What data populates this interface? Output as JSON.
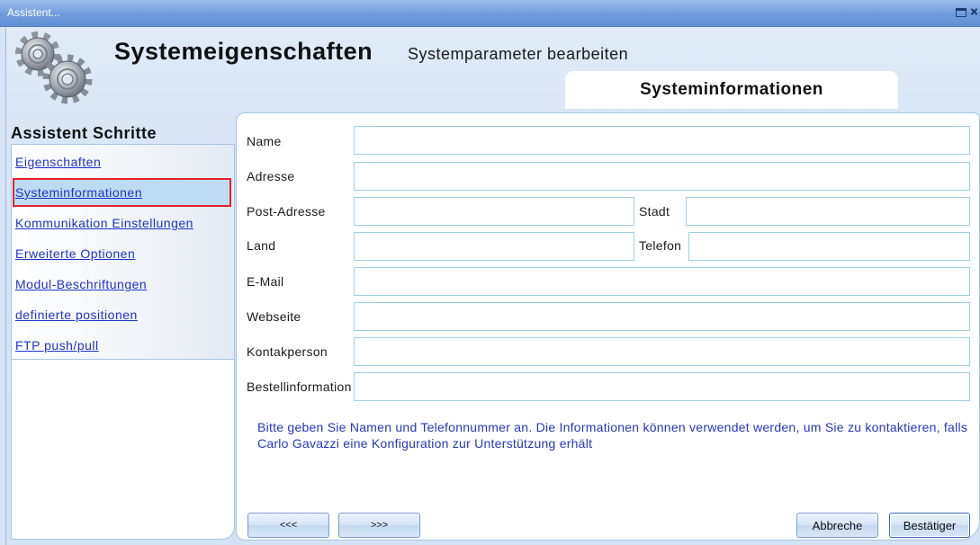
{
  "window": {
    "title": "Assistent...",
    "header_title": "Systemeigenschaften",
    "header_subtitle": "Systemparameter bearbeiten"
  },
  "tabs": [
    {
      "label": "Systeminformationen",
      "active": true
    }
  ],
  "sidebar": {
    "heading": "Assistent Schritte",
    "selected_index": 1,
    "items": [
      {
        "label": "Eigenschaften"
      },
      {
        "label": "Systeminformationen"
      },
      {
        "label": "Kommunikation Einstellungen"
      },
      {
        "label": "Erweiterte Optionen"
      },
      {
        "label": "Modul-Beschriftungen"
      },
      {
        "label": "definierte positionen"
      },
      {
        "label": "FTP push/pull"
      }
    ]
  },
  "form": {
    "name": {
      "label": "Name",
      "value": ""
    },
    "adresse": {
      "label": "Adresse",
      "value": ""
    },
    "post_adresse": {
      "label": "Post-Adresse",
      "value": ""
    },
    "stadt": {
      "label": "Stadt",
      "value": ""
    },
    "land": {
      "label": "Land",
      "value": ""
    },
    "telefon": {
      "label": "Telefon",
      "value": ""
    },
    "email": {
      "label": "E-Mail",
      "value": ""
    },
    "webseite": {
      "label": "Webseite",
      "value": ""
    },
    "kontaktperson": {
      "label": "Kontakperson",
      "value": ""
    },
    "bestellinformation": {
      "label": "Bestellinformation",
      "value": ""
    }
  },
  "info_text": {
    "line1": "Bitte geben Sie Namen und Telefonnummer an. Die Informationen können verwendet werden, um Sie zu kontaktieren, falls",
    "line2": "Carlo Gavazzi eine Konfiguration zur Unterstützung erhält"
  },
  "buttons": {
    "back": "<<<",
    "next": ">>>",
    "cancel": "Abbreche",
    "confirm": "Bestätiger"
  },
  "icons": {
    "header": "gears-icon",
    "restore": "restore-window-icon",
    "close": "close-icon"
  },
  "colors": {
    "title_bar": "#6f9cdb",
    "link": "#1d33cc",
    "info_text": "#2238c0",
    "selection_background": "#bddcf1",
    "selection_border": "#e0242a",
    "panel_border": "#a6c6e5",
    "field_border": "#9fcfe3"
  }
}
